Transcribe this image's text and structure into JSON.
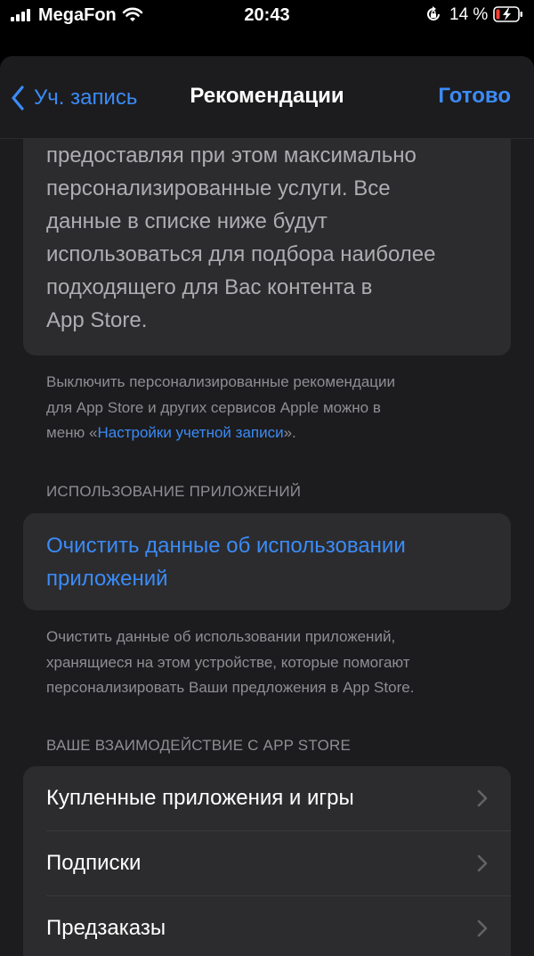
{
  "status_bar": {
    "carrier": "MegaFon",
    "time": "20:43",
    "battery_percent": "14 %"
  },
  "nav": {
    "back_label": "Уч. запись",
    "title": "Рекомендации",
    "done_label": "Готово"
  },
  "intro": {
    "lines": [
      "предоставляя при этом максимально",
      "персонализированные услуги. Все",
      "данные в списке ниже будут",
      "использоваться для подбора наиболее",
      "подходящего для Вас контента в",
      "App Store."
    ]
  },
  "personalization_note": {
    "line1": "Выключить персонализированные рекомендации",
    "line2": "для App Store и других сервисов Apple можно в",
    "line3_prefix": "меню «",
    "link": "Настройки учетной записи",
    "line3_suffix": "»."
  },
  "app_usage": {
    "header": "ИСПОЛЬЗОВАНИЕ ПРИЛОЖЕНИЙ",
    "clear_line1": "Очистить данные об использовании",
    "clear_line2": "приложений",
    "note_lines": [
      "Очистить данные об использовании приложений,",
      "хранящиеся на этом устройстве, которые помогают",
      "персонализировать Ваши предложения в App Store."
    ]
  },
  "interactions": {
    "header": "ВАШЕ ВЗАИМОДЕЙСТВИЕ С APP STORE",
    "rows": [
      {
        "label": "Купленные приложения и игры"
      },
      {
        "label": "Подписки"
      },
      {
        "label": "Предзаказы"
      }
    ]
  },
  "colors": {
    "accent": "#3b8bf7",
    "background": "#000000",
    "sheet": "#1c1c1e",
    "card": "#2c2c2e",
    "secondary_text": "#8e8e93",
    "battery_low": "#ff3b30"
  },
  "icons": [
    "signal-icon",
    "wifi-icon",
    "rotation-lock-icon",
    "battery-charging-icon",
    "chevron-left-icon",
    "chevron-right-icon"
  ]
}
